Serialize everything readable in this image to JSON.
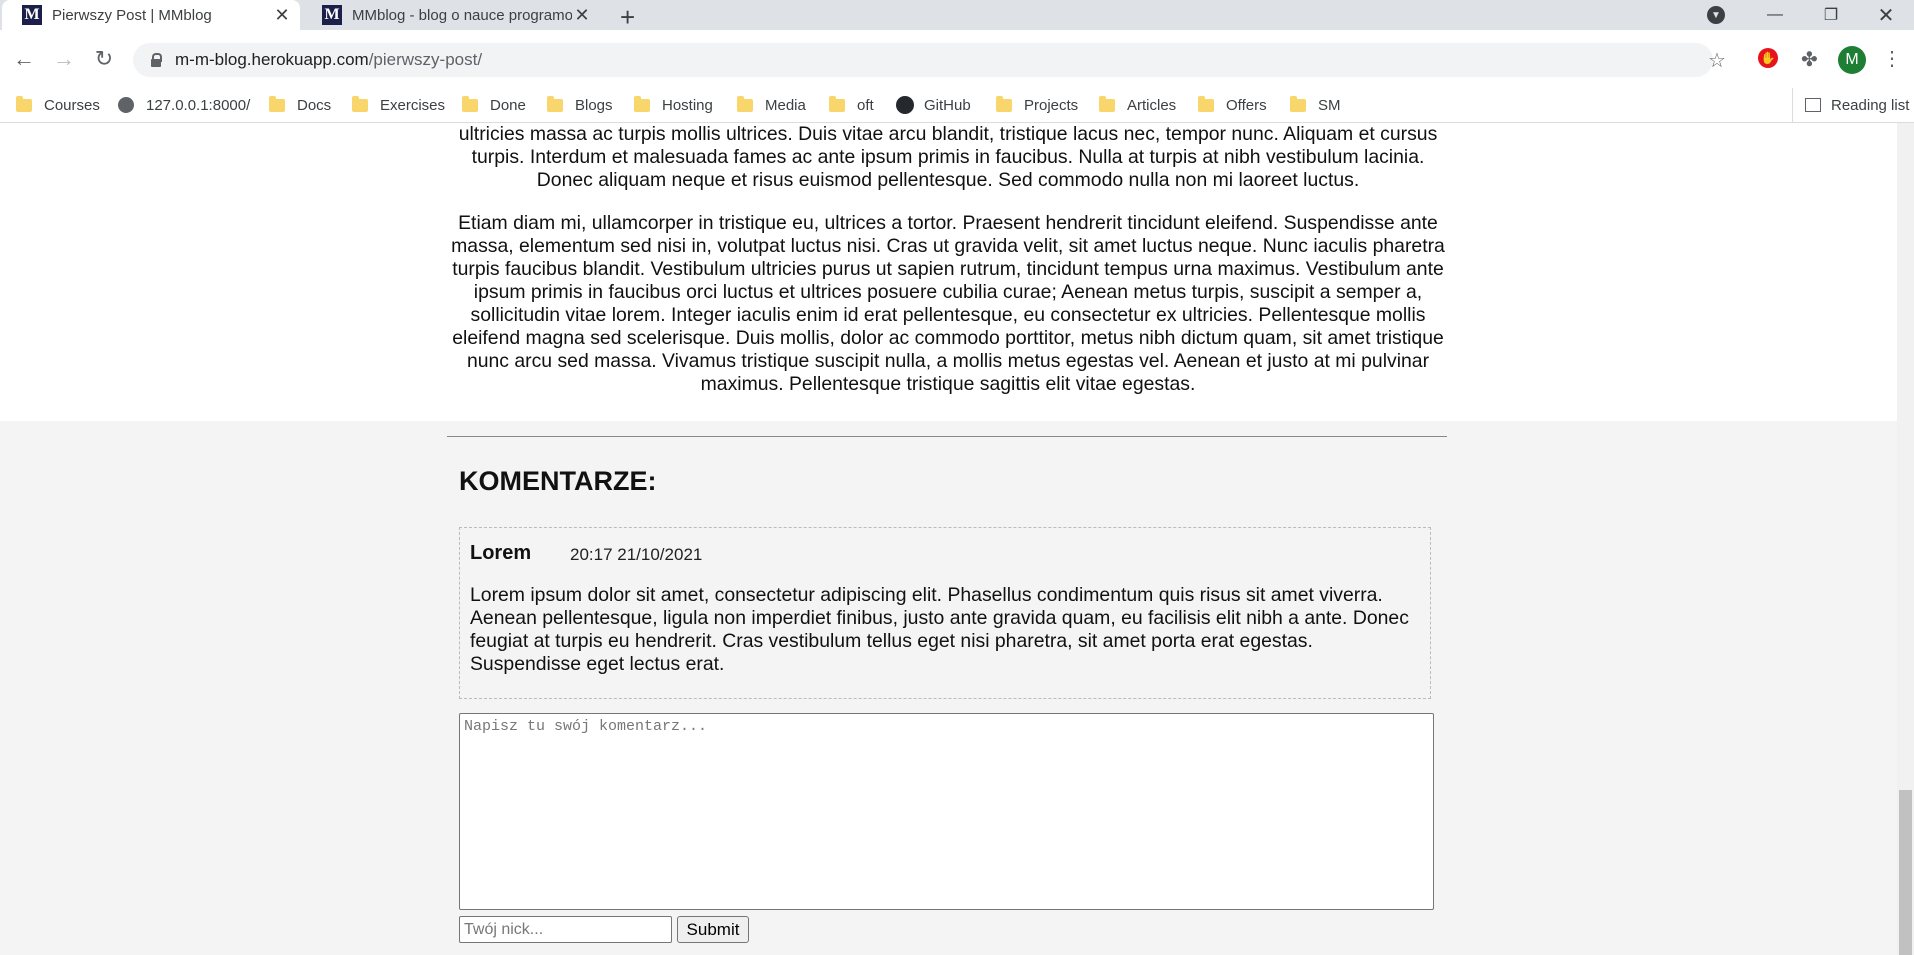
{
  "browser": {
    "tabs": [
      {
        "title": "Pierwszy Post | MMblog",
        "favicon": "M"
      },
      {
        "title": "MMblog - blog o nauce programowania",
        "favicon": "M"
      }
    ],
    "new_tab": "+",
    "url_host": "m-m-blog.herokuapp.com",
    "url_path": "/pierwszy-post/",
    "profile_initial": "M",
    "bookmarks": [
      "Courses",
      "127.0.0.1:8000/",
      "Docs",
      "Exercises",
      "Done",
      "Blogs",
      "Hosting",
      "Media",
      "oft",
      "GitHub",
      "Projects",
      "Articles",
      "Offers",
      "SM"
    ],
    "reading_list": "Reading list"
  },
  "article": {
    "paragraph_partial": "ultricies massa ac turpis mollis ultrices. Duis vitae arcu blandit, tristique lacus nec, tempor nunc. Aliquam et cursus turpis. Interdum et malesuada fames ac ante ipsum primis in faucibus. Nulla at turpis at nibh vestibulum lacinia. Donec aliquam neque et risus euismod pellentesque. Sed commodo nulla non mi laoreet luctus.",
    "paragraph": "Etiam diam mi, ullamcorper in tristique eu, ultrices a tortor. Praesent hendrerit tincidunt eleifend. Suspendisse ante massa, elementum sed nisi in, volutpat luctus nisi. Cras ut gravida velit, sit amet luctus neque. Nunc iaculis pharetra turpis faucibus blandit. Vestibulum ultricies purus ut sapien rutrum, tincidunt tempus urna maximus. Vestibulum ante ipsum primis in faucibus orci luctus et ultrices posuere cubilia curae; Aenean metus turpis, suscipit a semper a, sollicitudin vitae lorem. Integer iaculis enim id erat pellentesque, eu consectetur ex ultricies. Pellentesque mollis eleifend magna sed scelerisque. Duis mollis, dolor ac commodo porttitor, metus nibh dictum quam, sit amet tristique nunc arcu sed massa. Vivamus tristique suscipit nulla, a mollis metus egestas vel. Aenean et justo at mi pulvinar maximus. Pellentesque tristique sagittis elit vitae egestas."
  },
  "comments": {
    "heading": "KOMENTARZE:",
    "items": [
      {
        "author": "Lorem",
        "date": "20:17 21/10/2021",
        "body": "Lorem ipsum dolor sit amet, consectetur adipiscing elit. Phasellus condimentum quis risus sit amet viverra. Aenean pellentesque, ligula non imperdiet finibus, justo ante gravida quam, eu facilisis elit nibh a ante. Donec feugiat at turpis eu hendrerit. Cras vestibulum tellus eget nisi pharetra, sit amet porta erat egestas. Suspendisse eget lectus erat."
      }
    ],
    "form": {
      "comment_placeholder": "Napisz tu swój komentarz...",
      "nick_placeholder": "Twój nick...",
      "submit_label": "Submit"
    }
  }
}
